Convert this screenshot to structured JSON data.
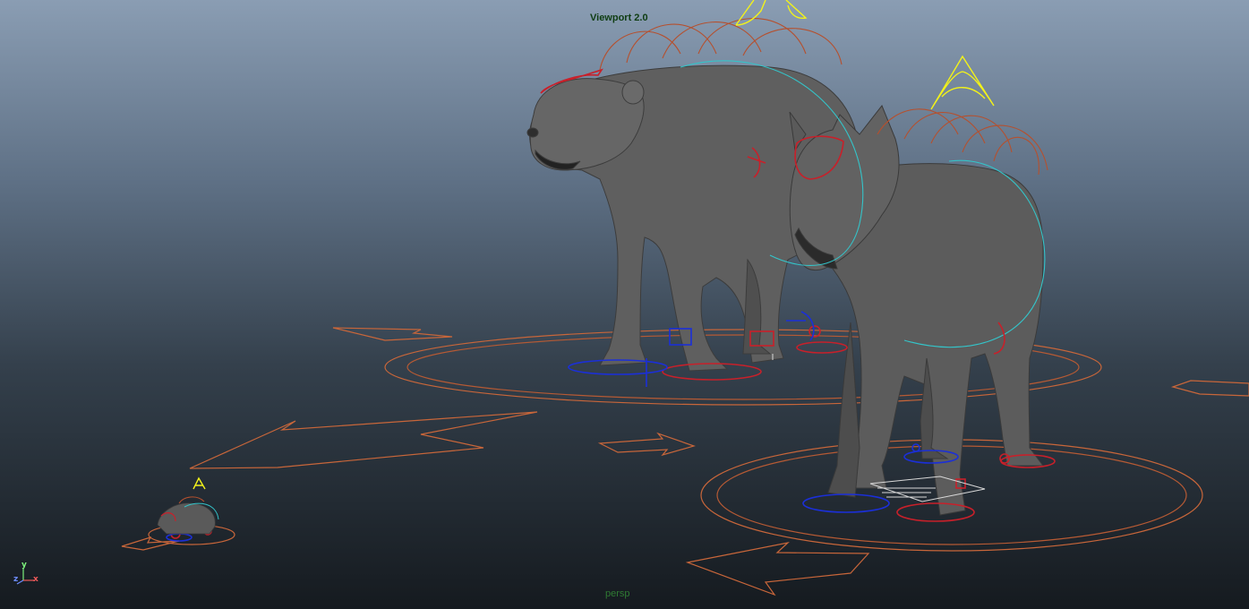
{
  "viewport": {
    "renderer_label": "Viewport 2.0",
    "camera_label": "persp"
  },
  "axis_gizmo": {
    "x": "x",
    "y": "y",
    "z": "z"
  },
  "colors": {
    "background_top": "#8a9db3",
    "background_bottom": "#151a1f",
    "mesh": "#5f5f5f",
    "rig_orange": "#c8663a",
    "rig_red": "#c8202a",
    "rig_blue": "#1b2fd8",
    "rig_cyan": "#34c4c9",
    "rig_yellow": "#f2f21a"
  }
}
